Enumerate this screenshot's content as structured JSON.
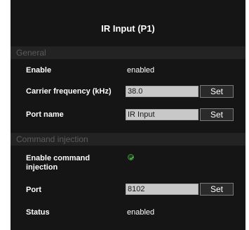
{
  "page": {
    "title": "IR Input (P1)"
  },
  "general": {
    "header": "General",
    "enable_label": "Enable",
    "enable_value": "enabled",
    "carrier_label": "Carrier frequency (kHz)",
    "carrier_value": "38.0",
    "carrier_set": "Set",
    "port_name_label": "Port name",
    "port_name_value": "IR Input",
    "port_name_set": "Set"
  },
  "command_injection": {
    "header": "Command injection",
    "enable_label": "Enable command injection",
    "enable_checked": true,
    "port_label": "Port",
    "port_value": "8102",
    "port_set": "Set",
    "status_label": "Status",
    "status_value": "enabled"
  },
  "colors": {
    "panel_bg": "#151515",
    "section_bg": "#232323",
    "section_text": "#5a5a5a",
    "input_bg": "#c8c8c8",
    "check_green": "#3d8a3d"
  },
  "icons": {
    "enable_command_injection": "checkmark-icon"
  }
}
